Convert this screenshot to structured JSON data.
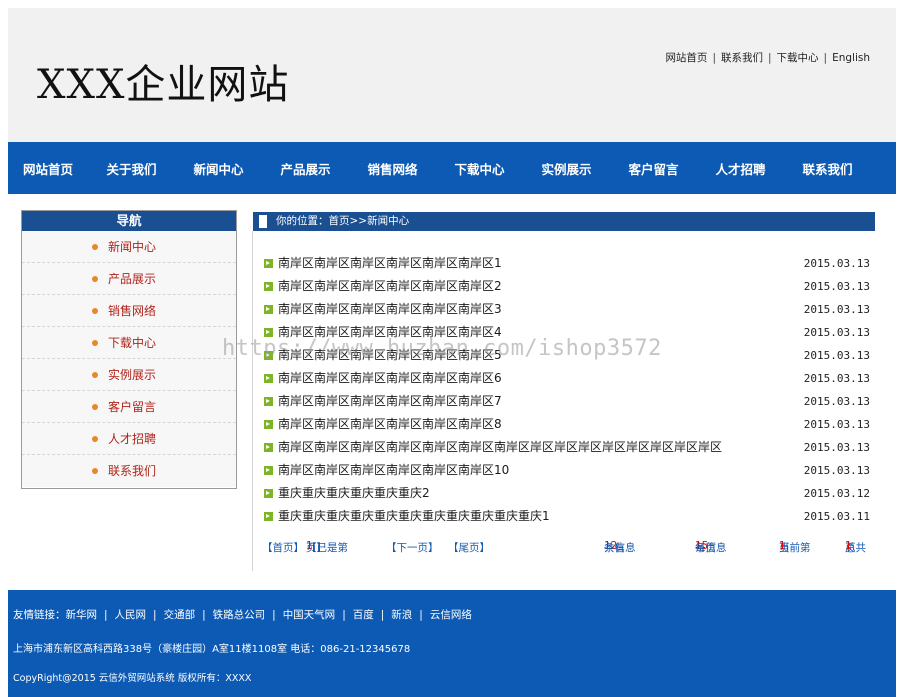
{
  "header": {
    "site_title": "XXX企业网站",
    "top_links": [
      "网站首页",
      "联系我们",
      "下载中心",
      "English"
    ]
  },
  "nav": {
    "items": [
      "网站首页",
      "关于我们",
      "新闻中心",
      "产品展示",
      "销售网络",
      "下载中心",
      "实例展示",
      "客户留言",
      "人才招聘",
      "联系我们"
    ]
  },
  "sidebar": {
    "title": "导航",
    "items": [
      "新闻中心",
      "产品展示",
      "销售网络",
      "下载中心",
      "实例展示",
      "客户留言",
      "人才招聘",
      "联系我们"
    ]
  },
  "breadcrumb": "你的位置：首页>>新闻中心",
  "news": [
    {
      "title": "南岸区南岸区南岸区南岸区南岸区南岸区1",
      "date": "2015.03.13"
    },
    {
      "title": "南岸区南岸区南岸区南岸区南岸区南岸区2",
      "date": "2015.03.13"
    },
    {
      "title": "南岸区南岸区南岸区南岸区南岸区南岸区3",
      "date": "2015.03.13"
    },
    {
      "title": "南岸区南岸区南岸区南岸区南岸区南岸区4",
      "date": "2015.03.13"
    },
    {
      "title": "南岸区南岸区南岸区南岸区南岸区南岸区5",
      "date": "2015.03.13"
    },
    {
      "title": "南岸区南岸区南岸区南岸区南岸区南岸区6",
      "date": "2015.03.13"
    },
    {
      "title": "南岸区南岸区南岸区南岸区南岸区南岸区7",
      "date": "2015.03.13"
    },
    {
      "title": "南岸区南岸区南岸区南岸区南岸区南岸区8",
      "date": "2015.03.13"
    },
    {
      "title": "南岸区南岸区南岸区南岸区南岸区南岸区南岸区岸区岸区岸区岸区岸区岸区岸区岸区",
      "date": "2015.03.13"
    },
    {
      "title": "南岸区南岸区南岸区南岸区南岸区南岸区10",
      "date": "2015.03.13"
    },
    {
      "title": "重庆重庆重庆重庆重庆重庆2",
      "date": "2015.03.12"
    },
    {
      "title": "重庆重庆重庆重庆重庆重庆重庆重庆重庆重庆重庆1",
      "date": "2015.03.11"
    }
  ],
  "pager": {
    "first": "【首页】",
    "prev_a": "【已是第",
    "prev_num": "1",
    "prev_b": "页】",
    "next": "【下一页】",
    "last": "【尾页】",
    "total_a": "共有",
    "total_num": "12",
    "total_b": "条信息",
    "per_a": "每页",
    "per_num": "15",
    "per_b": "条信息",
    "cur_a": "当前第",
    "cur_num": "1",
    "cur_b": "页",
    "pages_a": "总共",
    "pages_num": "1",
    "pages_b": "页"
  },
  "footer": {
    "links_label": "友情链接：",
    "links": [
      "新华网",
      "人民网",
      "交通部",
      "铁路总公司",
      "中国天气网",
      "百度",
      "新浪",
      "云信网络"
    ],
    "address": "上海市浦东新区高科西路338号（豪楼庄园）A室11楼1108室  电话：086-21-12345678",
    "copyright": "CopyRight@2015 云信外贸网站系统 版权所有：XXXX"
  },
  "watermark": "https://www.huzhan.com/ishop3572",
  "colors": {
    "nav_bg": "#0c5ab4",
    "sidebar_head_bg": "#1a4f92",
    "accent_red": "#e60000",
    "link_blue": "#1659ad",
    "bullet_green": "#7eb526"
  }
}
